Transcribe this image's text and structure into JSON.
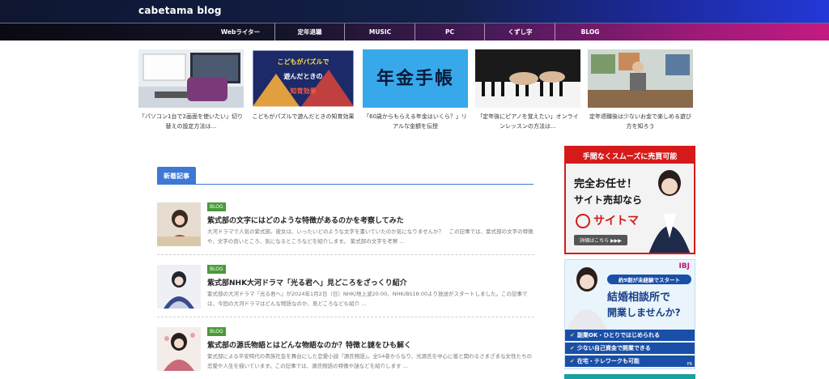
{
  "site": {
    "title": "cabetama blog"
  },
  "nav": [
    {
      "label": "Webライター"
    },
    {
      "label": "定年退職"
    },
    {
      "label": "MUSIC"
    },
    {
      "label": "PC"
    },
    {
      "label": "くずし字"
    },
    {
      "label": "BLOG"
    }
  ],
  "featured": [
    {
      "caption": "「パソコン1台で2画面を使いたい」切り替えの設定方法は…"
    },
    {
      "caption": "こどもがパズルで遊んだときの知育効果",
      "thumb_text_1": "こどもがパズルで",
      "thumb_text_2": "遊んだときの",
      "thumb_text_3": "知育効果"
    },
    {
      "caption": "「60歳からもらえる年金はいくら？」リアルな金額を伝授",
      "thumb_text": "年金手帳"
    },
    {
      "caption": "「定年後にピアノを覚えたい」オンラインレッスンの方法は…"
    },
    {
      "caption": "定年退職後は少ないお金で楽しめる遊び方を知ろう"
    }
  ],
  "section": {
    "title": "新着記事"
  },
  "posts": [
    {
      "badge": "BLOG",
      "title": "紫式部の文字にはどのような特徴があるのかを考察してみた",
      "excerpt": "大河ドラマで人気の紫式部。彼女は、いったいどのような文字を書いていたのか気になりませんか？　この記事では、紫式部の文字の特徴や、文字の良いところ、気になるところなどを紹介します。 紫式部の文字を考察 ..."
    },
    {
      "badge": "BLOG",
      "title": "紫式部NHK大河ドラマ「光る君へ」見どころをざっくり紹介",
      "excerpt": "紫式部の大河ドラマ「光る君へ」が2024年1月2日（日）NHK/地上波20:00、NHK/BS18:00より放送がスタートしました。この記事では、今回の大河ドラマはどんな物語なのか、見どころなども紹介 ..."
    },
    {
      "badge": "BLOG",
      "title": "紫式部の源氏物語とはどんな物語なのか？特徴と謎をひも解く",
      "excerpt": "紫式部による平安時代の貴族社会を舞台にした恋愛小説『源氏物語』。全54巻からなり、光源氏を中心に彼と関わるさまざまな女性たちの恋愛や人生を描いています。この記事では、源氏物語の特徴や謎などを紹介します ..."
    }
  ],
  "ads": {
    "saitoma": {
      "top": "手間なくスムーズに売買可能",
      "line1": "完全お任せ！",
      "line2": "サイト売却なら",
      "brand": "サイトマ",
      "button": "詳細はこちら ▶▶▶"
    },
    "ibj": {
      "logo": "IBJ",
      "pill": "約9割が未経験でスタート",
      "head1": "結婚相談所で",
      "head2": "開業しませんか?",
      "bullets": [
        "副業OK・ひとりではじめられる",
        "少ない自己資金で開業できる",
        "在宅・テレワークも可能"
      ],
      "pr": "PR"
    }
  },
  "colors": {
    "accent": "#3d78d6",
    "badge": "#4a9a3a",
    "ad_red": "#d61a1a",
    "ad_blue": "#1a4fa8"
  }
}
